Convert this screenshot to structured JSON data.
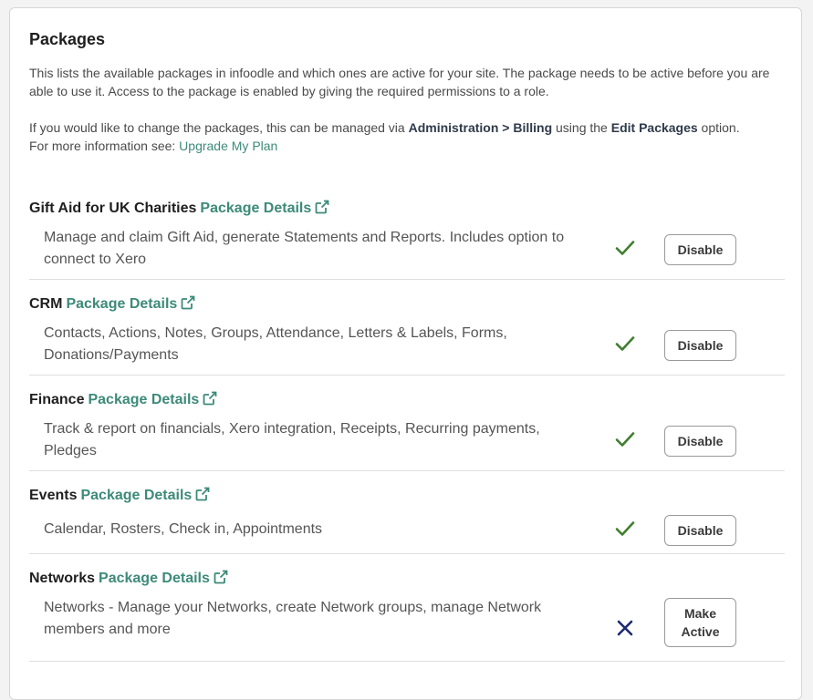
{
  "panel": {
    "title": "Packages",
    "intro_1": "This lists the available packages in infoodle and which ones are active for your site. The package needs to be active before you are able to use it. Access to the package is enabled by giving the required permissions to a role.",
    "intro_2_before": "If you would like to change the packages, this can be managed via ",
    "intro_2_path": "Administration > Billing",
    "intro_2_mid": " using the ",
    "intro_2_action": "Edit Packages",
    "intro_2_after": " option.",
    "intro_3_before": "For more information see: ",
    "intro_3_link": "Upgrade My Plan"
  },
  "details_label": "Package Details",
  "packages": [
    {
      "name": "Gift Aid for UK Charities",
      "description": "Manage and claim Gift Aid, generate Statements and Reports. Includes option to connect to Xero",
      "active": true,
      "button": "Disable",
      "status_icon": "check-icon"
    },
    {
      "name": "CRM",
      "description": "Contacts, Actions, Notes, Groups, Attendance, Letters & Labels, Forms, Donations/Payments",
      "active": true,
      "button": "Disable",
      "status_icon": "check-icon"
    },
    {
      "name": "Finance",
      "description": "Track & report on financials, Xero integration, Receipts, Recurring payments, Pledges",
      "active": true,
      "button": "Disable",
      "status_icon": "check-icon"
    },
    {
      "name": "Events",
      "description": "Calendar, Rosters, Check in, Appointments",
      "active": true,
      "button": "Disable",
      "status_icon": "check-icon"
    },
    {
      "name": "Networks",
      "description": "Networks - Manage your Networks, create Network groups, manage Network members and more",
      "active": false,
      "button": "Make Active",
      "status_icon": "cross-icon"
    }
  ],
  "colors": {
    "link": "#3d8a7a",
    "check": "#3f7f2e",
    "cross": "#1c2a6e"
  }
}
